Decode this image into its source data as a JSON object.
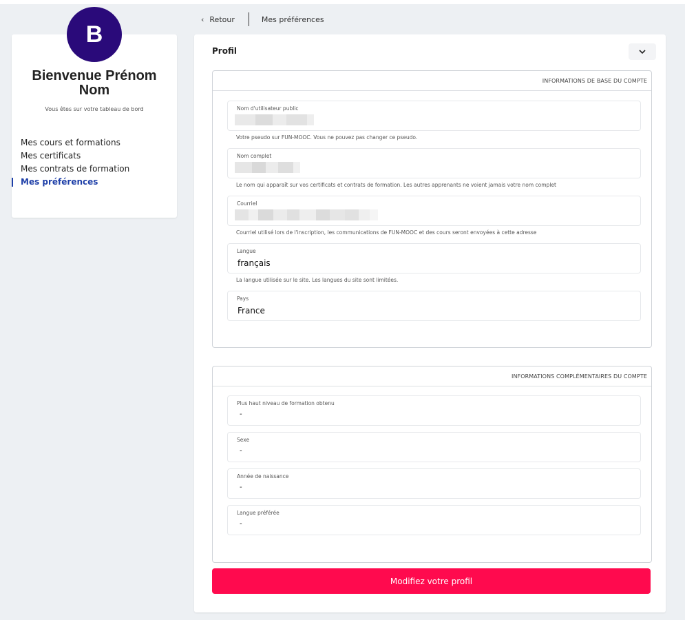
{
  "breadcrumb": {
    "back_label": "Retour",
    "current": "Mes préférences"
  },
  "sidebar": {
    "avatar_letter": "B",
    "welcome_line1": "Bienvenue Prénom",
    "welcome_line2": "Nom",
    "subtitle": "Vous êtes sur votre tableau de bord",
    "nav_items": [
      {
        "label": "Mes cours et formations",
        "active": false
      },
      {
        "label": "Mes certificats",
        "active": false
      },
      {
        "label": "Mes contrats de formation",
        "active": false
      },
      {
        "label": "Mes préférences",
        "active": true
      }
    ],
    "accent_color": "#1e3fa8",
    "avatar_color": "#2a0a7a"
  },
  "profile": {
    "title": "Profil",
    "collapse_icon": "chevron-down-icon",
    "basic_section": {
      "title": "INFORMATIONS DE BASE DU COMPTE",
      "fields": [
        {
          "label": "Nom d'utilisateur public",
          "value": "",
          "help": "Votre pseudo sur FUN-MOOC. Vous ne pouvez pas changer ce pseudo."
        },
        {
          "label": "Nom complet",
          "value": "",
          "help": "Le nom qui apparaît sur vos certificats et contrats de formation. Les autres apprenants ne voient jamais votre nom complet"
        },
        {
          "label": "Courriel",
          "value": "",
          "help": "Courriel utilisé lors de l'inscription, les communications de FUN-MOOC et des cours seront envoyées à cette adresse"
        },
        {
          "label": "Langue",
          "value": "français",
          "help": "La langue utilisée sur le site. Les langues du site sont limitées."
        },
        {
          "label": "Pays",
          "value": "France",
          "help": ""
        }
      ]
    },
    "extra_section": {
      "title": "INFORMATIONS COMPLÉMENTAIRES DU COMPTE",
      "fields": [
        {
          "label": "Plus haut niveau de formation obtenu",
          "value": "-"
        },
        {
          "label": "Sexe",
          "value": "-"
        },
        {
          "label": "Année de naissance",
          "value": "-"
        },
        {
          "label": "Langue préférée",
          "value": "-"
        }
      ]
    },
    "submit_label": "Modifiez votre profil",
    "submit_color": "#ff0a4e"
  }
}
